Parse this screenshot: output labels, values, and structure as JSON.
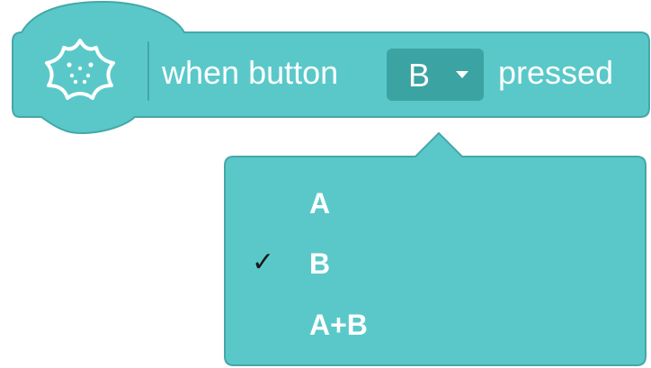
{
  "colors": {
    "block_fill": "#5ac8c9",
    "block_border": "#45a7a8",
    "dropdown_fill": "#3ca3a3",
    "menu_fill": "#5ac8c9",
    "text": "#ffffff",
    "checkmark": "#1a1a1a"
  },
  "block": {
    "icon": "microbit-star-icon",
    "text_before": "when button",
    "text_after": "pressed",
    "dropdown": {
      "selected_value": "B",
      "caret_icon": "caret-down-icon"
    }
  },
  "dropdown_menu": {
    "checkmark_glyph": "✓",
    "items": [
      {
        "label": "A",
        "selected": false
      },
      {
        "label": "B",
        "selected": true
      },
      {
        "label": "A+B",
        "selected": false
      }
    ]
  }
}
